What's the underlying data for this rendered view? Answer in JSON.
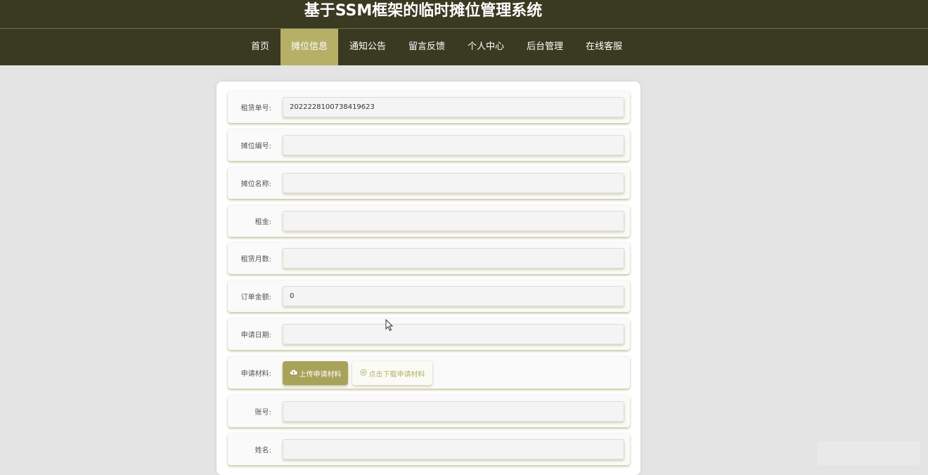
{
  "header": {
    "title": "基于SSM框架的临时摊位管理系统"
  },
  "nav": {
    "items": [
      {
        "label": "首页",
        "active": false
      },
      {
        "label": "摊位信息",
        "active": true
      },
      {
        "label": "通知公告",
        "active": false
      },
      {
        "label": "留言反馈",
        "active": false
      },
      {
        "label": "个人中心",
        "active": false
      },
      {
        "label": "后台管理",
        "active": false
      },
      {
        "label": "在线客服",
        "active": false
      }
    ]
  },
  "form": {
    "rental_no": {
      "label": "租赁单号:",
      "value": "2022228100738419623"
    },
    "stall_no": {
      "label": "摊位编号:",
      "value": ""
    },
    "stall_name": {
      "label": "摊位名称:",
      "value": ""
    },
    "rent": {
      "label": "租金:",
      "value": ""
    },
    "months": {
      "label": "租赁月数:",
      "value": ""
    },
    "amount": {
      "label": "订单金额:",
      "value": "0"
    },
    "apply_date": {
      "label": "申请日期:",
      "value": ""
    },
    "materials": {
      "label": "申请材料:",
      "upload_label": "上传申请材料",
      "download_label": "点击下载申请材料",
      "upload_icon": "cloud-upload-icon",
      "download_icon": "plus-circle-icon"
    },
    "account": {
      "label": "账号:",
      "value": ""
    },
    "name": {
      "label": "姓名:",
      "value": ""
    }
  },
  "colors": {
    "header_bg": "#3a3a22",
    "nav_active_bg": "#b5b066",
    "upload_btn_bg": "#a8a35a",
    "page_bg": "#e4e4e4"
  }
}
